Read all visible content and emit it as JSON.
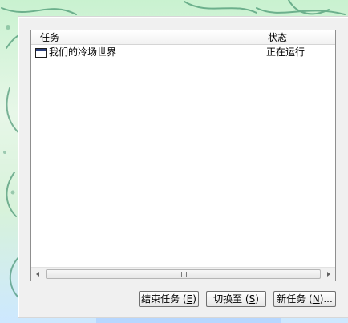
{
  "list": {
    "columns": {
      "task": "任务",
      "status": "状态"
    },
    "rows": [
      {
        "icon": "app-window-icon",
        "task": "我们的冷场世界",
        "status": "正在运行"
      }
    ]
  },
  "scrollbar": {
    "grip_text": "III"
  },
  "buttons": {
    "end_task": {
      "prefix": "结束任务",
      "paren_open": " (",
      "mnemonic": "E",
      "paren_close": ")"
    },
    "switch_to": {
      "prefix": "切换至",
      "paren_open": " (",
      "mnemonic": "S",
      "paren_close": ")"
    },
    "new_task": {
      "prefix": "新任务",
      "paren_open": " (",
      "mnemonic": "N",
      "paren_close": ")..."
    }
  }
}
